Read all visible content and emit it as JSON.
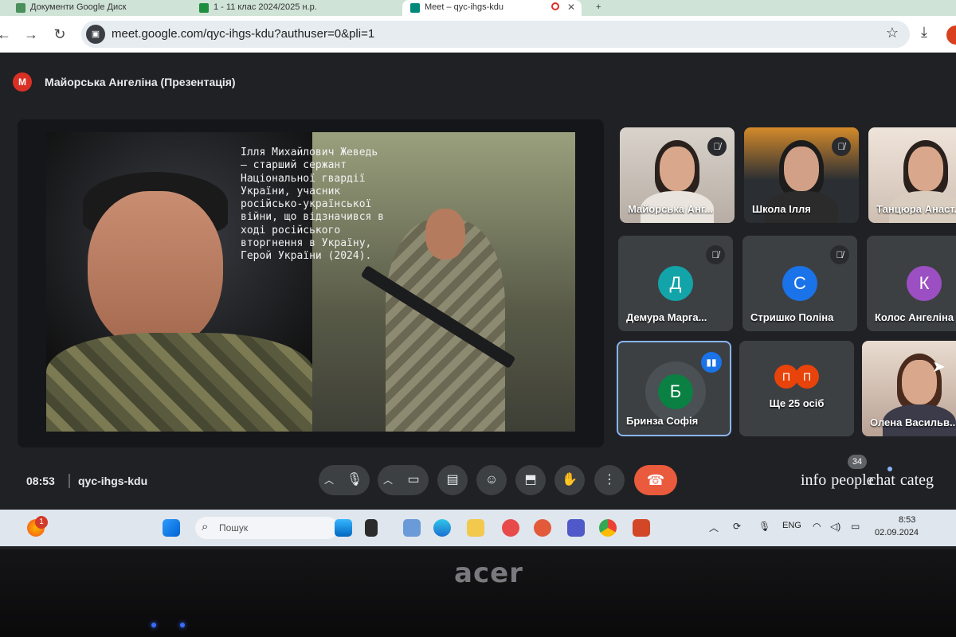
{
  "browser": {
    "tabs": [
      {
        "label": "Документи Google Диск"
      },
      {
        "label": "1 - 11 клас 2024/2025 н.р."
      },
      {
        "label": "Meet – qyc-ihgs-kdu"
      }
    ],
    "url": "meet.google.com/qyc-ihgs-kdu?authuser=0&pli=1"
  },
  "meet": {
    "presenter_avatar": "М",
    "presenter_title": "Майорська Ангеліна (Презентація)",
    "slide_caption": "Ілля Михайлович Жеведь\n— старший сержант\nНаціональної гвардії\nУкраїни, учасник\nросійсько-української\nвійни, що відзначився в\nході російського\nвторгнення в Україну,\nГерой України (2024).",
    "tiles": [
      {
        "name": "Майорська Анг..."
      },
      {
        "name": "Школа Ілля"
      },
      {
        "name": "Танцюра Анаст..."
      },
      {
        "name": "Демура Марга...",
        "avatar": "Д",
        "color": "#12a4a8"
      },
      {
        "name": "Стришко Поліна",
        "avatar": "С",
        "color": "#1a73e8"
      },
      {
        "name": "Колос Ангеліна",
        "avatar": "К",
        "color": "#9c4fc2"
      },
      {
        "name": "Бринза Софія",
        "avatar": "Б",
        "color": "#0b8043"
      },
      {
        "name": "Ще 25 осіб",
        "avatars": [
          "П",
          "П"
        ]
      },
      {
        "name": "Олена Васильв..."
      }
    ],
    "meeting_time": "08:53",
    "meeting_code": "qyc-ihgs-kdu",
    "side_labels": {
      "info": "info",
      "people": "people",
      "chat": "chat",
      "categ": "categ"
    },
    "people_count": "34"
  },
  "taskbar": {
    "weather_badge": "1",
    "search_placeholder": "Пошук",
    "language": "ENG",
    "time": "8:53",
    "date": "02.09.2024"
  },
  "laptop": {
    "brand": "acer"
  },
  "colors": {
    "end_call": "#ea5a3c",
    "accent": "#8ab4f8",
    "meet_bg": "#202124"
  }
}
